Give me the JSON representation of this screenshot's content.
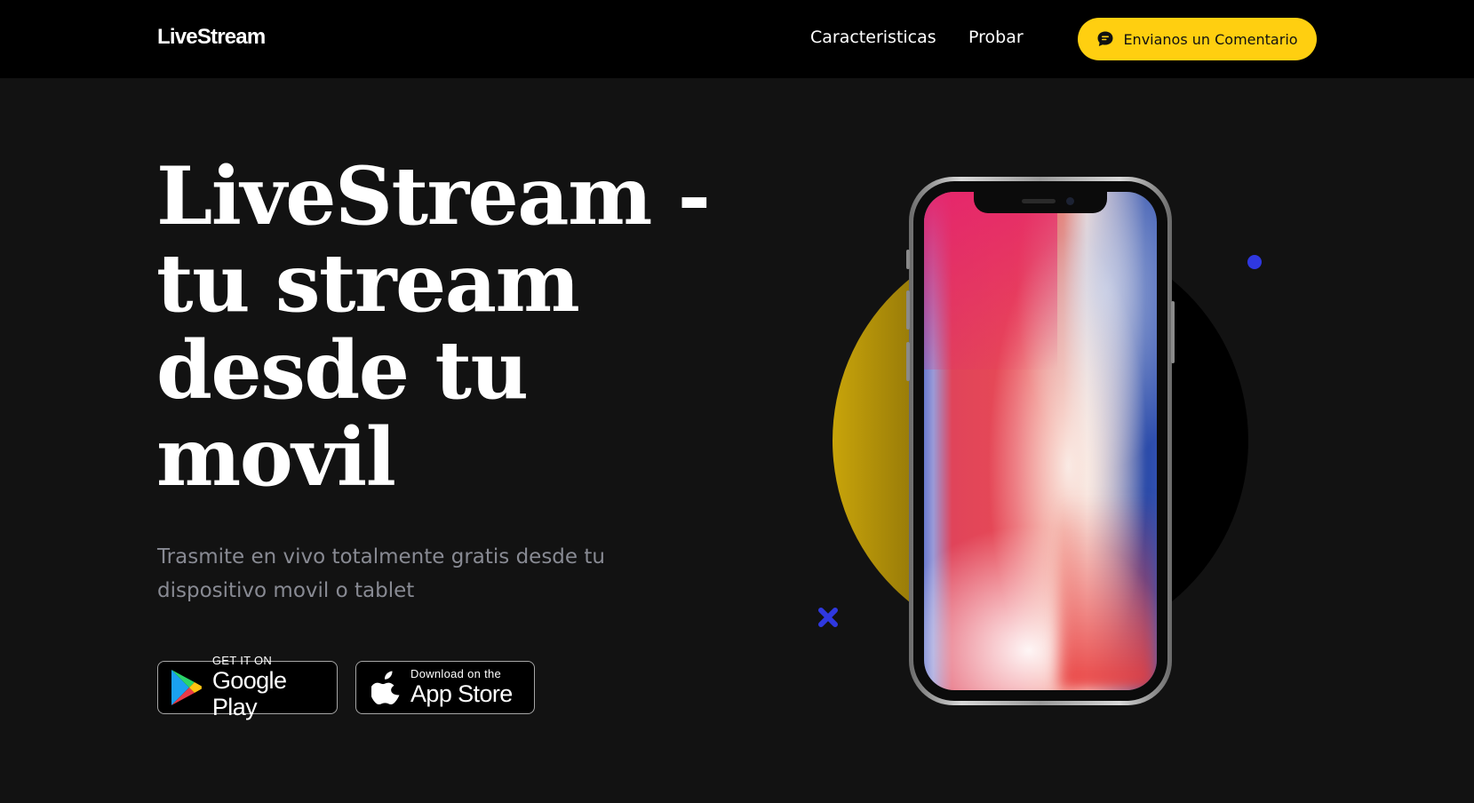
{
  "nav": {
    "logo": "LiveStream",
    "links": [
      {
        "label": "Caracteristicas"
      },
      {
        "label": "Probar"
      }
    ],
    "cta": {
      "label": "Envianos un Comentario",
      "icon": "chat-bubble-icon"
    }
  },
  "hero": {
    "title_lines": [
      "LiveStream -",
      "tu stream",
      "desde tu",
      "movil"
    ],
    "subtitle": "Trasmite en vivo totalmente gratis desde tu dispositivo movil o tablet"
  },
  "store_badges": {
    "google": {
      "small": "GET IT ON",
      "big": "Google Play",
      "icon": "google-play-icon"
    },
    "apple": {
      "small": "Download on the",
      "big": "App Store",
      "icon": "apple-icon"
    }
  },
  "colors": {
    "accent": "#ffcf10",
    "background": "#121212",
    "nav_background": "#000000",
    "decor_blue": "#2f38e0",
    "subtitle_gray": "#888a93"
  }
}
